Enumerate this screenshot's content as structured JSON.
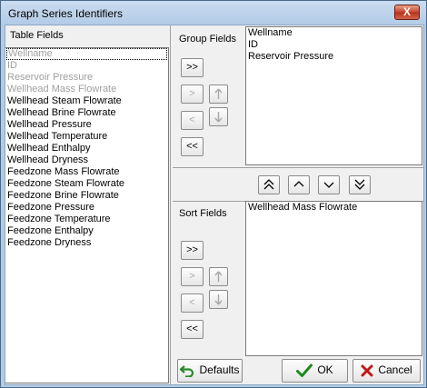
{
  "window": {
    "title": "Graph Series Identifiers",
    "close_symbol": "X"
  },
  "table_fields": {
    "label": "Table Fields",
    "items": [
      {
        "text": "Wellname",
        "enabled": false,
        "focused": true
      },
      {
        "text": "ID",
        "enabled": false
      },
      {
        "text": "Reservoir Pressure",
        "enabled": false
      },
      {
        "text": "Wellhead Mass Flowrate",
        "enabled": false
      },
      {
        "text": "Wellhead Steam Flowrate",
        "enabled": true
      },
      {
        "text": "Wellhead Brine Flowrate",
        "enabled": true
      },
      {
        "text": "Wellhead Pressure",
        "enabled": true
      },
      {
        "text": "Wellhead Temperature",
        "enabled": true
      },
      {
        "text": "Wellhead Enthalpy",
        "enabled": true
      },
      {
        "text": "Wellhead Dryness",
        "enabled": true
      },
      {
        "text": "Feedzone Mass Flowrate",
        "enabled": true
      },
      {
        "text": "Feedzone Steam Flowrate",
        "enabled": true
      },
      {
        "text": "Feedzone Brine Flowrate",
        "enabled": true
      },
      {
        "text": "Feedzone Pressure",
        "enabled": true
      },
      {
        "text": "Feedzone Temperature",
        "enabled": true
      },
      {
        "text": "Feedzone Enthalpy",
        "enabled": true
      },
      {
        "text": "Feedzone Dryness",
        "enabled": true
      }
    ]
  },
  "group_fields": {
    "label": "Group Fields",
    "items": [
      "Wellname",
      "ID",
      "Reservoir Pressure"
    ],
    "buttons": {
      "add_all": ">>",
      "add": ">",
      "remove": "<",
      "remove_all": "<<"
    }
  },
  "sort_fields": {
    "label": "Sort Fields",
    "items": [
      "Wellhead Mass Flowrate"
    ],
    "buttons": {
      "add_all": ">>",
      "add": ">",
      "remove": "<",
      "remove_all": "<<"
    }
  },
  "footer": {
    "defaults_label": "Defaults",
    "ok_label": "OK",
    "cancel_label": "Cancel"
  },
  "icons": {
    "close": "close-icon",
    "move_up": "arrow-up-icon",
    "move_down": "arrow-down-icon",
    "move_top": "double-chevron-up-icon",
    "move_bottom": "double-chevron-down-icon",
    "defaults": "undo-arrow-icon",
    "ok": "checkmark-icon",
    "cancel": "x-icon"
  },
  "colors": {
    "ok_green": "#1d8a1d",
    "cancel_red": "#c01818",
    "defaults_green": "#2b8a2b"
  }
}
